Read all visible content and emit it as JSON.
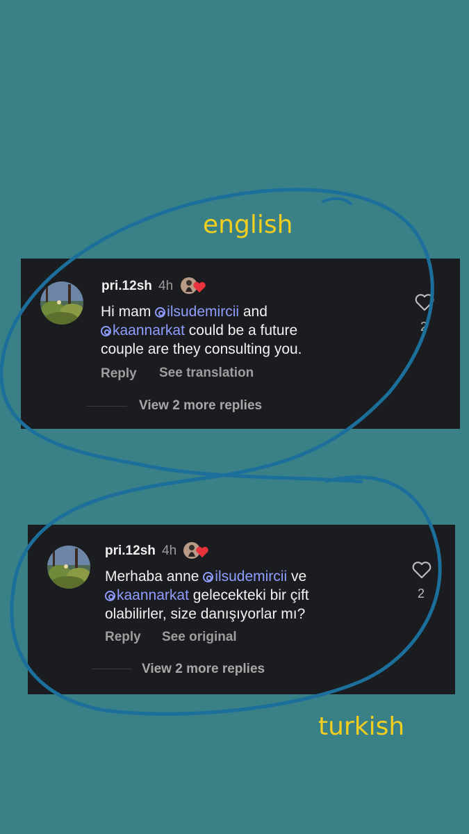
{
  "labels": {
    "top": "english",
    "bottom": "turkish"
  },
  "cards": [
    {
      "username": "pri.12sh",
      "time": "4h",
      "text_parts": [
        "Hi mam ",
        "ilsudemircii",
        " and",
        "kaannarkat",
        " could be a future",
        "couple are they consulting you."
      ],
      "reply": "Reply",
      "secondary": "See translation",
      "more_replies": "View 2 more replies",
      "likes": "2"
    },
    {
      "username": "pri.12sh",
      "time": "4h",
      "text_parts": [
        "Merhaba anne ",
        "ilsudemircii",
        " ve",
        "kaannarkat",
        " gelecekteki bir çift",
        "olabilirler, size danışıyorlar mı?"
      ],
      "reply": "Reply",
      "secondary": "See original",
      "more_replies": "View 2 more replies",
      "likes": "2"
    }
  ],
  "colors": {
    "background": "#3a8087",
    "card": "#1a1c20",
    "label": "#f2cf1f",
    "mention": "#8f9dff",
    "scribble": "#1b6f9a"
  }
}
